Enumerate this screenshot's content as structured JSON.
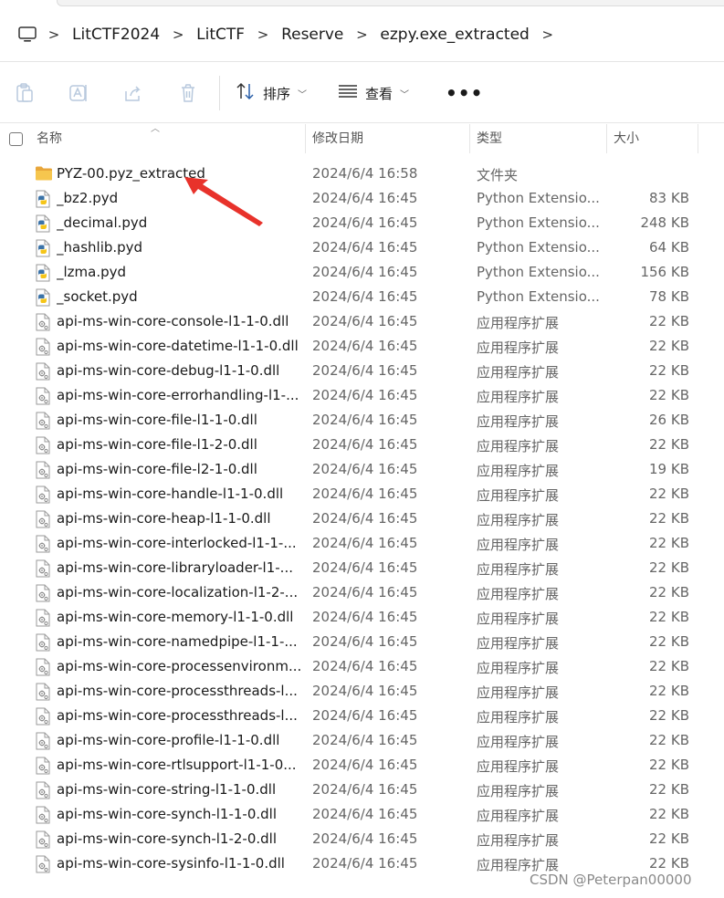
{
  "address": {
    "crumbs": [
      "LitCTF2024",
      "LitCTF",
      "Reserve",
      "ezpy.exe_extracted"
    ],
    "separator": ">"
  },
  "toolbar": {
    "sort_label": "排序",
    "view_label": "查看",
    "more_label": "•••"
  },
  "columns": {
    "name": "名称",
    "date": "修改日期",
    "type": "类型",
    "size": "大小"
  },
  "files": [
    {
      "name": "PYZ-00.pyz_extracted",
      "date": "2024/6/4 16:58",
      "type": "文件夹",
      "size": "",
      "icon": "folder-icon"
    },
    {
      "name": "_bz2.pyd",
      "date": "2024/6/4 16:45",
      "type": "Python Extensio...",
      "size": "83 KB",
      "icon": "python-file-icon"
    },
    {
      "name": "_decimal.pyd",
      "date": "2024/6/4 16:45",
      "type": "Python Extensio...",
      "size": "248 KB",
      "icon": "python-file-icon"
    },
    {
      "name": "_hashlib.pyd",
      "date": "2024/6/4 16:45",
      "type": "Python Extensio...",
      "size": "64 KB",
      "icon": "python-file-icon"
    },
    {
      "name": "_lzma.pyd",
      "date": "2024/6/4 16:45",
      "type": "Python Extensio...",
      "size": "156 KB",
      "icon": "python-file-icon"
    },
    {
      "name": "_socket.pyd",
      "date": "2024/6/4 16:45",
      "type": "Python Extensio...",
      "size": "78 KB",
      "icon": "python-file-icon"
    },
    {
      "name": "api-ms-win-core-console-l1-1-0.dll",
      "date": "2024/6/4 16:45",
      "type": "应用程序扩展",
      "size": "22 KB",
      "icon": "dll-file-icon"
    },
    {
      "name": "api-ms-win-core-datetime-l1-1-0.dll",
      "date": "2024/6/4 16:45",
      "type": "应用程序扩展",
      "size": "22 KB",
      "icon": "dll-file-icon"
    },
    {
      "name": "api-ms-win-core-debug-l1-1-0.dll",
      "date": "2024/6/4 16:45",
      "type": "应用程序扩展",
      "size": "22 KB",
      "icon": "dll-file-icon"
    },
    {
      "name": "api-ms-win-core-errorhandling-l1-...",
      "date": "2024/6/4 16:45",
      "type": "应用程序扩展",
      "size": "22 KB",
      "icon": "dll-file-icon"
    },
    {
      "name": "api-ms-win-core-file-l1-1-0.dll",
      "date": "2024/6/4 16:45",
      "type": "应用程序扩展",
      "size": "26 KB",
      "icon": "dll-file-icon"
    },
    {
      "name": "api-ms-win-core-file-l1-2-0.dll",
      "date": "2024/6/4 16:45",
      "type": "应用程序扩展",
      "size": "22 KB",
      "icon": "dll-file-icon"
    },
    {
      "name": "api-ms-win-core-file-l2-1-0.dll",
      "date": "2024/6/4 16:45",
      "type": "应用程序扩展",
      "size": "19 KB",
      "icon": "dll-file-icon"
    },
    {
      "name": "api-ms-win-core-handle-l1-1-0.dll",
      "date": "2024/6/4 16:45",
      "type": "应用程序扩展",
      "size": "22 KB",
      "icon": "dll-file-icon"
    },
    {
      "name": "api-ms-win-core-heap-l1-1-0.dll",
      "date": "2024/6/4 16:45",
      "type": "应用程序扩展",
      "size": "22 KB",
      "icon": "dll-file-icon"
    },
    {
      "name": "api-ms-win-core-interlocked-l1-1-...",
      "date": "2024/6/4 16:45",
      "type": "应用程序扩展",
      "size": "22 KB",
      "icon": "dll-file-icon"
    },
    {
      "name": "api-ms-win-core-libraryloader-l1-...",
      "date": "2024/6/4 16:45",
      "type": "应用程序扩展",
      "size": "22 KB",
      "icon": "dll-file-icon"
    },
    {
      "name": "api-ms-win-core-localization-l1-2-...",
      "date": "2024/6/4 16:45",
      "type": "应用程序扩展",
      "size": "22 KB",
      "icon": "dll-file-icon"
    },
    {
      "name": "api-ms-win-core-memory-l1-1-0.dll",
      "date": "2024/6/4 16:45",
      "type": "应用程序扩展",
      "size": "22 KB",
      "icon": "dll-file-icon"
    },
    {
      "name": "api-ms-win-core-namedpipe-l1-1-...",
      "date": "2024/6/4 16:45",
      "type": "应用程序扩展",
      "size": "22 KB",
      "icon": "dll-file-icon"
    },
    {
      "name": "api-ms-win-core-processenvironm...",
      "date": "2024/6/4 16:45",
      "type": "应用程序扩展",
      "size": "22 KB",
      "icon": "dll-file-icon"
    },
    {
      "name": "api-ms-win-core-processthreads-l...",
      "date": "2024/6/4 16:45",
      "type": "应用程序扩展",
      "size": "22 KB",
      "icon": "dll-file-icon"
    },
    {
      "name": "api-ms-win-core-processthreads-l...",
      "date": "2024/6/4 16:45",
      "type": "应用程序扩展",
      "size": "22 KB",
      "icon": "dll-file-icon"
    },
    {
      "name": "api-ms-win-core-profile-l1-1-0.dll",
      "date": "2024/6/4 16:45",
      "type": "应用程序扩展",
      "size": "22 KB",
      "icon": "dll-file-icon"
    },
    {
      "name": "api-ms-win-core-rtlsupport-l1-1-0...",
      "date": "2024/6/4 16:45",
      "type": "应用程序扩展",
      "size": "22 KB",
      "icon": "dll-file-icon"
    },
    {
      "name": "api-ms-win-core-string-l1-1-0.dll",
      "date": "2024/6/4 16:45",
      "type": "应用程序扩展",
      "size": "22 KB",
      "icon": "dll-file-icon"
    },
    {
      "name": "api-ms-win-core-synch-l1-1-0.dll",
      "date": "2024/6/4 16:45",
      "type": "应用程序扩展",
      "size": "22 KB",
      "icon": "dll-file-icon"
    },
    {
      "name": "api-ms-win-core-synch-l1-2-0.dll",
      "date": "2024/6/4 16:45",
      "type": "应用程序扩展",
      "size": "22 KB",
      "icon": "dll-file-icon"
    },
    {
      "name": "api-ms-win-core-sysinfo-l1-1-0.dll",
      "date": "2024/6/4 16:45",
      "type": "应用程序扩展",
      "size": "22 KB",
      "icon": "dll-file-icon"
    }
  ],
  "watermark": "CSDN @Peterpan00000",
  "colors": {
    "annotation_arrow": "#e8322b",
    "folder": "#f2c14e",
    "python_blue": "#3b73a8",
    "python_yellow": "#f5c518"
  }
}
